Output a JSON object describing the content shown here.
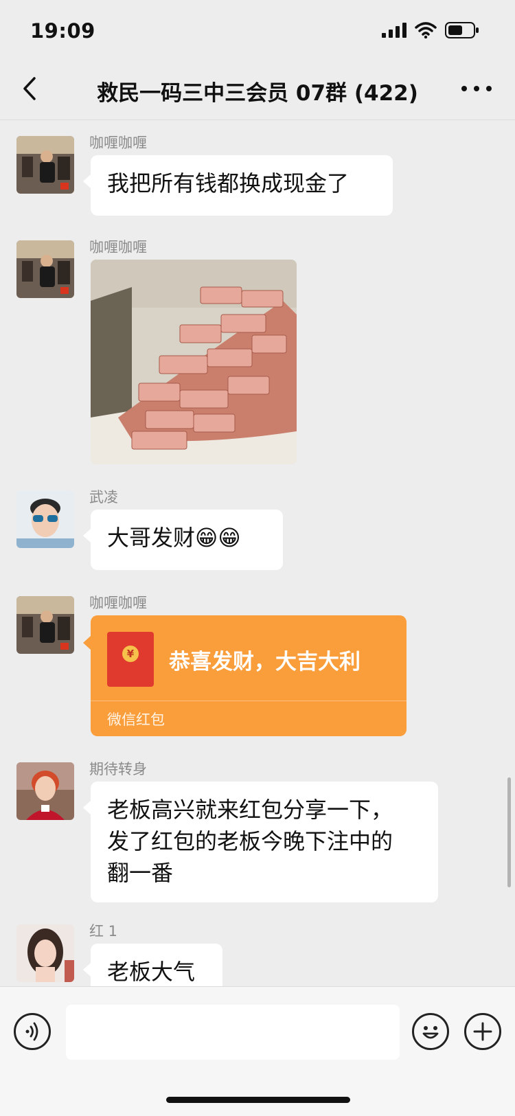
{
  "status_bar": {
    "time": "19:09"
  },
  "header": {
    "title": "救民一码三中三会员 07群 (422)"
  },
  "messages": [
    {
      "sender": "咖喱咖喱",
      "text": "我把所有钱都换成现金了"
    },
    {
      "sender": "咖喱咖喱",
      "image": "stacks of banknotes"
    },
    {
      "sender": "武凌",
      "text": "大哥发财😁😁"
    },
    {
      "sender": "咖喱咖喱",
      "red_packet": {
        "title": "恭喜发财，大吉大利",
        "footer": "微信红包"
      }
    },
    {
      "sender": "期待转身",
      "text": "老板高兴就来红包分享一下，\n发了红包的老板今晚下注中的\n翻一番"
    },
    {
      "sender": "红 1",
      "text": "老板大气"
    }
  ],
  "icons": {
    "back": "chevron-left-icon",
    "more": "ellipsis-icon",
    "voice": "voice-icon",
    "emoji": "emoji-icon",
    "plus": "plus-icon"
  },
  "colors": {
    "background": "#ededed",
    "red_packet": "#fa9d3b",
    "bubble": "#ffffff"
  }
}
